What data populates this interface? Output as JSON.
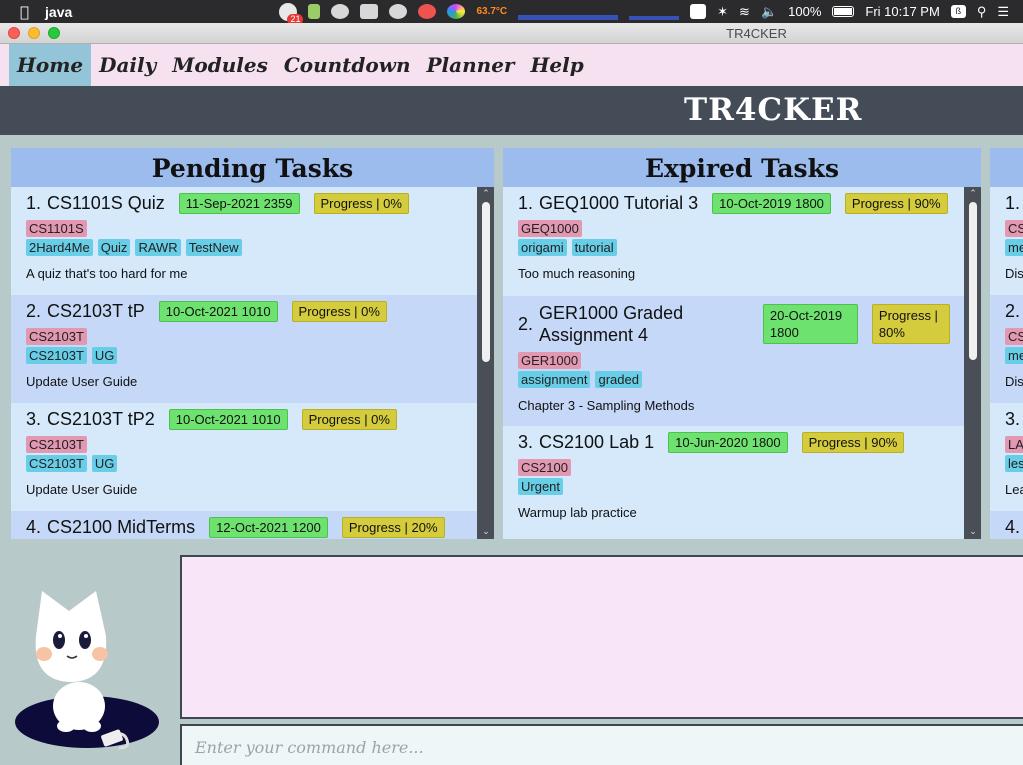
{
  "system_bar": {
    "app_name": "java",
    "notification_count": "21",
    "cpu_temp": "63.7°C",
    "battery": "100%",
    "clock": "Fri 10:17 PM",
    "keyboard": "ß"
  },
  "window": {
    "title": "TR4CKER"
  },
  "nav": {
    "items": [
      "Home",
      "Daily",
      "Modules",
      "Countdown",
      "Planner",
      "Help"
    ]
  },
  "header": {
    "logo": "TR4CKER"
  },
  "pending": {
    "title": "Pending Tasks",
    "tasks": [
      {
        "index": "1.",
        "name": "CS1101S Quiz",
        "date": "11-Sep-2021 2359",
        "progress": "Progress | 0%",
        "module": "CS1101S",
        "tags": [
          "2Hard4Me",
          "Quiz",
          "RAWR",
          "TestNew"
        ],
        "desc": "A quiz that's too hard for me"
      },
      {
        "index": "2.",
        "name": "CS2103T tP",
        "date": "10-Oct-2021 1010",
        "progress": "Progress | 0%",
        "module": "CS2103T",
        "tags": [
          "CS2103T",
          "UG"
        ],
        "desc": "Update User Guide"
      },
      {
        "index": "3.",
        "name": "CS2103T tP2",
        "date": "10-Oct-2021 1010",
        "progress": "Progress | 0%",
        "module": "CS2103T",
        "tags": [
          "CS2103T",
          "UG"
        ],
        "desc": "Update User Guide"
      },
      {
        "index": "4.",
        "name": "CS2100 MidTerms",
        "date": "12-Oct-2021 1200",
        "progress": "Progress | 20%"
      }
    ]
  },
  "expired": {
    "title": "Expired Tasks",
    "tasks": [
      {
        "index": "1.",
        "name": "GEQ1000 Tutorial 3",
        "date": "10-Oct-2019 1800",
        "progress": "Progress | 90%",
        "module": "GEQ1000",
        "tags": [
          "origami",
          "tutorial"
        ],
        "desc": "Too much reasoning"
      },
      {
        "index": "2.",
        "name": "GER1000 Graded Assignment 4",
        "date": "20-Oct-2019 1800",
        "progress": "Progress | 80%",
        "module": "GER1000",
        "tags": [
          "assignment",
          "graded"
        ],
        "desc": "Chapter 3 - Sampling Methods"
      },
      {
        "index": "3.",
        "name": "CS2100 Lab 1",
        "date": "10-Jun-2020 1800",
        "progress": "Progress | 90%",
        "module": "CS2100",
        "tags": [
          "Urgent"
        ],
        "desc": "Warmup lab practice"
      }
    ]
  },
  "third_panel": {
    "rows": [
      {
        "index": "1.",
        "mod": "CS",
        "tag": "me",
        "desc": "Dis"
      },
      {
        "index": "2.",
        "mod": "CS",
        "tag": "me",
        "desc": "Dis"
      },
      {
        "index": "3.",
        "mod": "LA",
        "tag": "les",
        "desc": "Lea"
      },
      {
        "index": "4."
      }
    ]
  },
  "command": {
    "placeholder": "Enter your command here..."
  },
  "colors": {
    "date_pill": "#6ee26e",
    "progress_pill": "#d4cc3c",
    "module_tag": "#e298b0",
    "general_tag": "#68cde6",
    "active_nav": "#94c4d8"
  }
}
